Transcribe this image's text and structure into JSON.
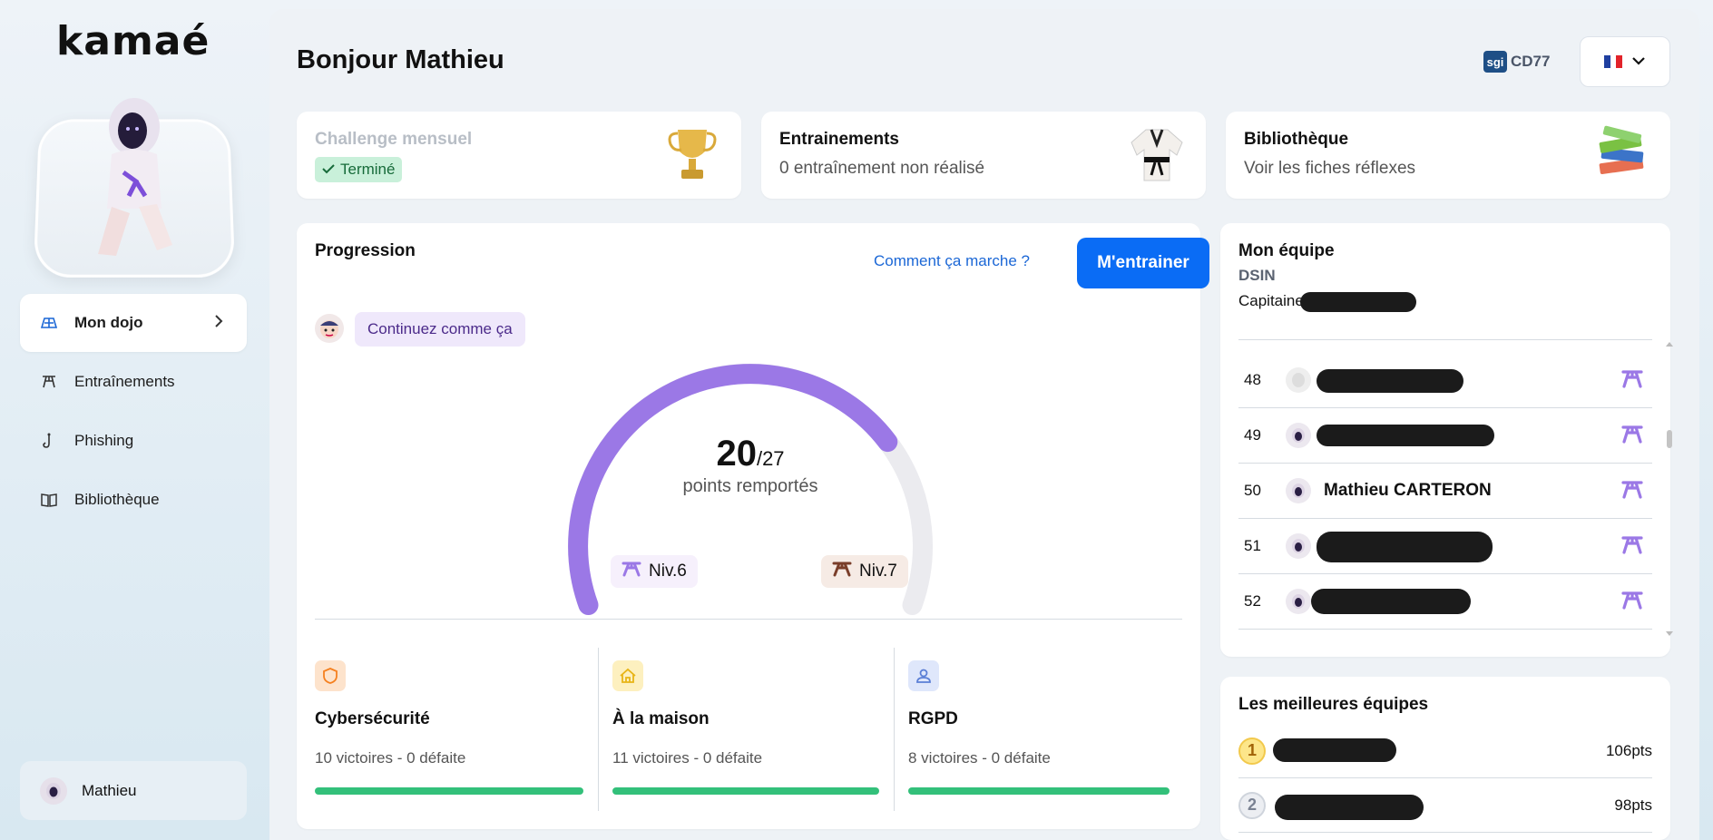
{
  "brand": {
    "logo": "kamaé"
  },
  "sidebar": {
    "items": [
      {
        "label": "Mon dojo",
        "icon": "dojo-icon",
        "active": true
      },
      {
        "label": "Entraînements",
        "icon": "belt-icon"
      },
      {
        "label": "Phishing",
        "icon": "hook-icon"
      },
      {
        "label": "Bibliothèque",
        "icon": "book-icon"
      }
    ],
    "user": {
      "name": "Mathieu"
    }
  },
  "header": {
    "greeting": "Bonjour Mathieu",
    "org": {
      "logo_text": "sgi",
      "code": "CD77"
    },
    "language": "fr"
  },
  "cards": {
    "challenge": {
      "title": "Challenge mensuel",
      "status": "Terminé"
    },
    "trainings": {
      "title": "Entrainements",
      "subtitle": "0 entraînement non réalisé"
    },
    "library": {
      "title": "Bibliothèque",
      "subtitle": "Voir les fiches réflexes"
    }
  },
  "progression": {
    "title": "Progression",
    "how_link": "Comment ça marche ?",
    "train_button": "M'entrainer",
    "message": "Continuez comme ça",
    "score": "20",
    "total": "/27",
    "score_label": "points remportés",
    "gauge_fraction": 0.74,
    "level_current": "Niv.6",
    "level_next": "Niv.7",
    "categories": [
      {
        "name": "Cybersécurité",
        "stats": "10 victoires - 0 défaite",
        "color": "#f5801f"
      },
      {
        "name": "À la maison",
        "stats": "11 victoires - 0 défaite",
        "color": "#e8b416"
      },
      {
        "name": "RGPD",
        "stats": "8 victoires - 0 défaite",
        "color": "#5b7fd6"
      }
    ]
  },
  "team": {
    "title": "Mon équipe",
    "name": "DSIN",
    "captain_label": "Capitaine :",
    "members": [
      {
        "rank": "48",
        "name": ""
      },
      {
        "rank": "49",
        "name": ""
      },
      {
        "rank": "50",
        "name": "Mathieu CARTERON"
      },
      {
        "rank": "51",
        "name": ""
      },
      {
        "rank": "52",
        "name": ""
      }
    ]
  },
  "best_teams": {
    "title": "Les meilleures équipes",
    "rows": [
      {
        "rank": "1",
        "points": "106pts"
      },
      {
        "rank": "2",
        "points": "98pts"
      }
    ]
  }
}
